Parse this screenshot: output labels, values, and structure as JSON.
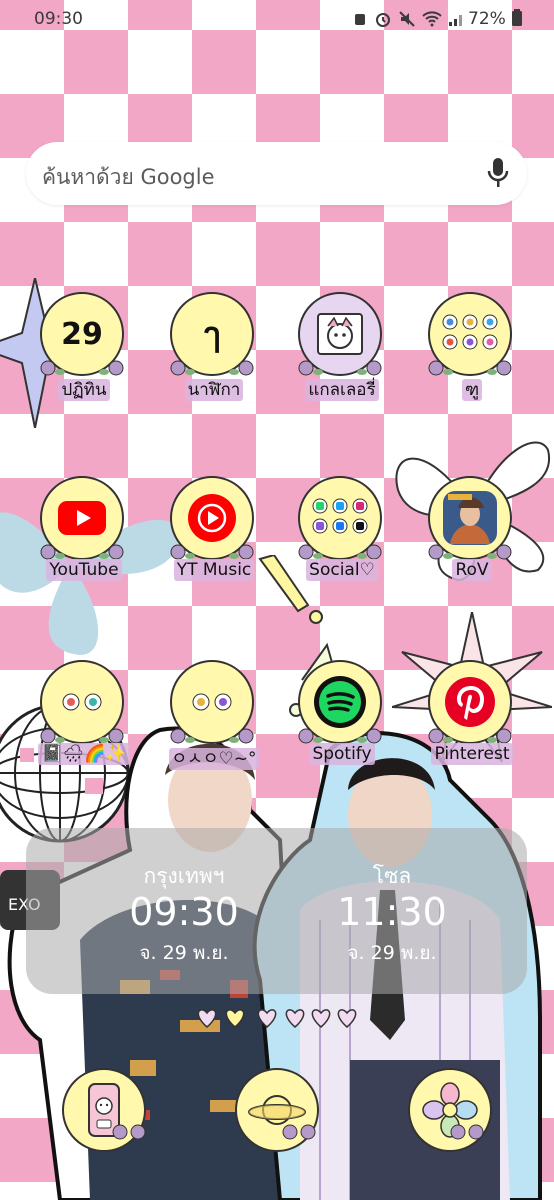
{
  "status_bar": {
    "time": "09:30",
    "battery": "72%",
    "icons": [
      "alarm-off-icon",
      "alarm-icon",
      "mute-icon",
      "wifi-icon",
      "signal-icon",
      "battery-icon"
    ]
  },
  "search": {
    "placeholder": "ค้นหาด้วย Google",
    "mic_icon": "mic-icon"
  },
  "apps": {
    "row1": [
      {
        "label": "ปฏิทิน",
        "icon": "calendar-icon",
        "icon_text": "29"
      },
      {
        "label": "นาฬิกา",
        "icon": "clock-icon",
        "icon_text": "ๅ"
      },
      {
        "label": "แกลเลอรี่",
        "icon": "gallery-icon"
      },
      {
        "label": "ฑู",
        "icon": "folder-icon"
      }
    ],
    "row2": [
      {
        "label": "YouTube",
        "icon": "youtube-icon"
      },
      {
        "label": "YT Music",
        "icon": "yt-music-icon"
      },
      {
        "label": "Social♡",
        "icon": "social-folder-icon"
      },
      {
        "label": "RoV",
        "icon": "rov-game-icon"
      }
    ],
    "row3": [
      {
        "label": "📓🌧🌈✨",
        "icon": "folder-icon"
      },
      {
        "label": "ㅇㅅㅇ♡~°",
        "icon": "folder-icon"
      },
      {
        "label": "Spotify",
        "icon": "spotify-icon"
      },
      {
        "label": "Pinterest",
        "icon": "pinterest-icon"
      }
    ]
  },
  "clock_widget": {
    "left": {
      "city": "กรุงเทพฯ",
      "time": "09:30",
      "date": "จ. 29 พ.ย."
    },
    "right": {
      "city": "โซล",
      "time": "11:30",
      "date": "จ. 29 พ.ย."
    }
  },
  "dock": {
    "icons": [
      "phone-icon",
      "planet-icon",
      "flower-icon"
    ]
  },
  "colors": {
    "check_pink": "#f3a7c6",
    "icon_yellow": "#fff8ad",
    "label_bg": "#d8b4de",
    "youtube_red": "#ff0000",
    "spotify_green": "#1ed760",
    "pinterest_red": "#e60023"
  }
}
